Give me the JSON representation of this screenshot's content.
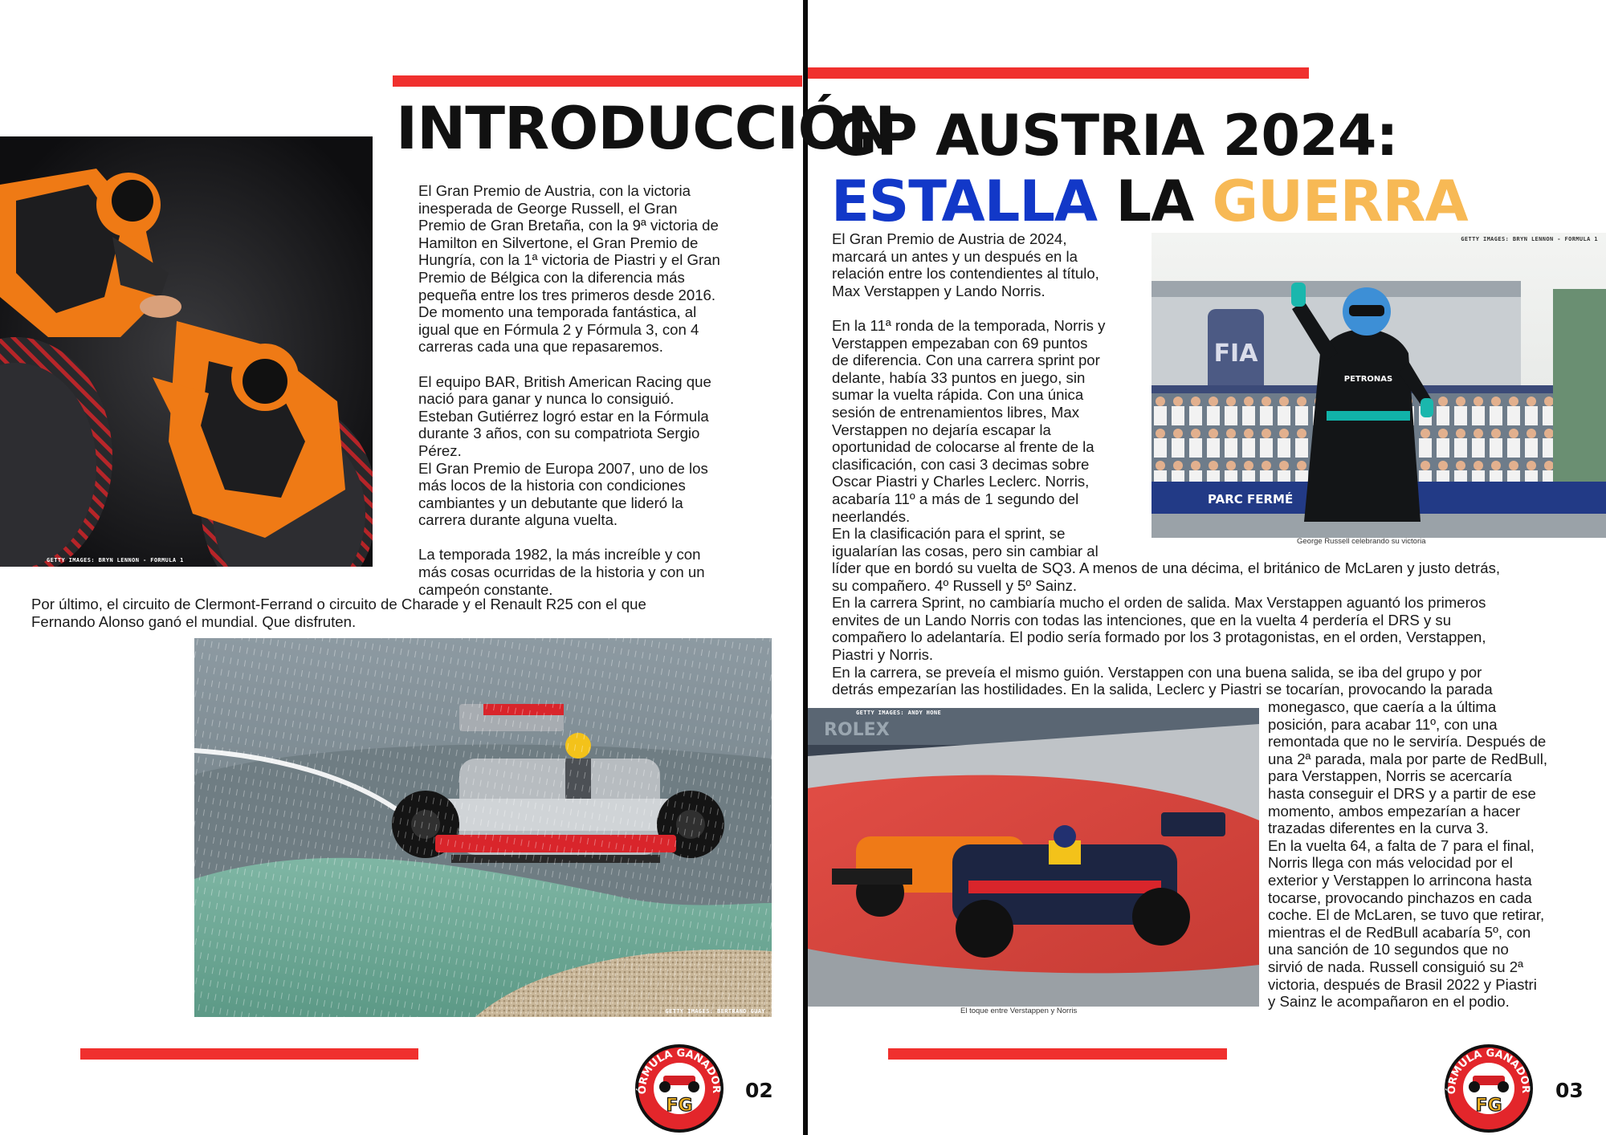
{
  "left_page": {
    "title": "INTRODUCCIÓN",
    "paragraphs_narrow": [
      "El Gran Premio de Austria, con la victoria",
      "inesperada de George Russell, el Gran",
      "Premio de Gran Bretaña, con la 9ª victoria de",
      "Hamilton en Silvertone, el Gran Premio de",
      "Hungría, con la 1ª victoria de Piastri y el Gran",
      "Premio de Bélgica con la diferencia más",
      "pequeña entre los tres primeros desde 2016.",
      "De momento una temporada fantástica, al",
      "igual que en Fórmula 2 y Fórmula 3, con 4",
      "carreras cada una que repasaremos.",
      "",
      "El equipo BAR, British American Racing que",
      "nació para ganar y nunca lo consiguió.",
      "Esteban Gutiérrez logró estar en la Fórmula",
      "durante 3 años, con su compatriota Sergio",
      "Pérez.",
      "El Gran Premio de Europa 2007, uno de los",
      "más locos de la historia con condiciones",
      "cambiantes y un debutante que lideró la",
      "carrera durante alguna vuelta.",
      "",
      "La temporada 1982, la más increíble y con",
      "más cosas ocurridas de la historia y con un",
      "campeón constante."
    ],
    "paragraph_wide": [
      "Por último, el circuito de Clermont-Ferrand o circuito de Charade y el Renault R25 con el que",
      "Fernando Alonso ganó el mundial. Que disfruten."
    ],
    "photo_top_credit": "GETTY IMAGES: BRYN LENNON - FORMULA 1",
    "photo_bottom_credit": "GETTY IMAGES: BERTRAND GUAY",
    "page_number": "02"
  },
  "right_page": {
    "title_line1": "GP AUSTRIA 2024:",
    "title_line2": {
      "word1": "ESTALLA",
      "word2": "LA",
      "word3": "GUERRA"
    },
    "column_lines": [
      "El Gran Premio de Austria de 2024,",
      "marcará un antes y un después en la",
      "relación entre los contendientes al título,",
      "Max Verstappen y Lando Norris.",
      "",
      "En la 11ª ronda de la temporada, Norris y",
      "Verstappen empezaban con 69 puntos",
      "de diferencia. Con una carrera sprint por",
      "delante, había 33 puntos en juego, sin",
      "sumar la vuelta rápida. Con una única",
      "sesión de entrenamientos libres, Max",
      "Verstappen no dejaría escapar la",
      "oportunidad de colocarse al frente de la",
      "clasificación, con casi 3 decimas sobre",
      "Oscar Piastri y Charles Leclerc. Norris,",
      "acabaría 11º a más de 1 segundo del",
      "neerlandés.",
      "En la clasificación para el sprint, se",
      "igualarían las cosas, pero sin cambiar al"
    ],
    "full_width_lines": [
      "líder que en bordó su vuelta de SQ3. A menos de una décima, el británico de McLaren y justo detrás,",
      "su compañero. 4º Russell y 5º Sainz.",
      "En la carrera Sprint, no cambiaría mucho el orden de salida. Max Verstappen aguantó los primeros",
      "envites de un Lando Norris con todas las intenciones, que en la vuelta 4 perdería el DRS y su",
      "compañero lo adelantaría. El podio sería formado por los 3 protagonistas, en el orden, Verstappen,",
      "Piastri y Norris.",
      "En la carrera, se preveía el mismo guión. Verstappen con una buena salida, se iba del grupo y por",
      "detrás empezarían las hostilidades. En la salida, Leclerc y Piastri se tocarían, provocando la parada"
    ],
    "side_column_lines": [
      "monegasco, que caería a la última",
      "posición, para acabar 11º, con una",
      "remontada que no le serviría. Después de",
      "una 2ª parada, mala por parte de RedBull,",
      "para Verstappen, Norris se acercaría",
      "hasta conseguir el DRS y a partir de ese",
      "momento, ambos empezarían a hacer",
      "trazadas diferentes en la curva 3.",
      "En la vuelta 64, a falta de 7 para el final,",
      "Norris llega con más velocidad por el",
      "exterior y Verstappen lo arrincona hasta",
      "tocarse, provocando pinchazos en cada",
      "coche. El de McLaren, se tuvo que retirar,",
      "mientras el de RedBull acabaría 5º, con",
      "una sanción de 10 segundos que no",
      "sirvió de nada. Russell consiguió su 2ª",
      "victoria, después de Brasil 2022 y Piastri",
      "y Sainz le acompañaron en el podio."
    ],
    "photo_russell_credit": "GETTY IMAGES: BRYN LENNON - FORMULA 1",
    "photo_russell_caption": "George Russell celebrando su victoria",
    "parc_ferme_text": "PARC FERMÉ",
    "petronas_text": "PETRONAS",
    "photo_crash_credit": "GETTY IMAGES: ANDY HONE",
    "photo_crash_caption": "El toque entre Verstappen y Norris",
    "page_number": "03"
  },
  "logo": {
    "top_text": "FÓRMULA GANADORA",
    "initials": "FG"
  },
  "colors": {
    "accent_red": "#f0302e",
    "title_blue": "#1238c8",
    "title_gold": "#f7b955",
    "ink": "#111111"
  }
}
